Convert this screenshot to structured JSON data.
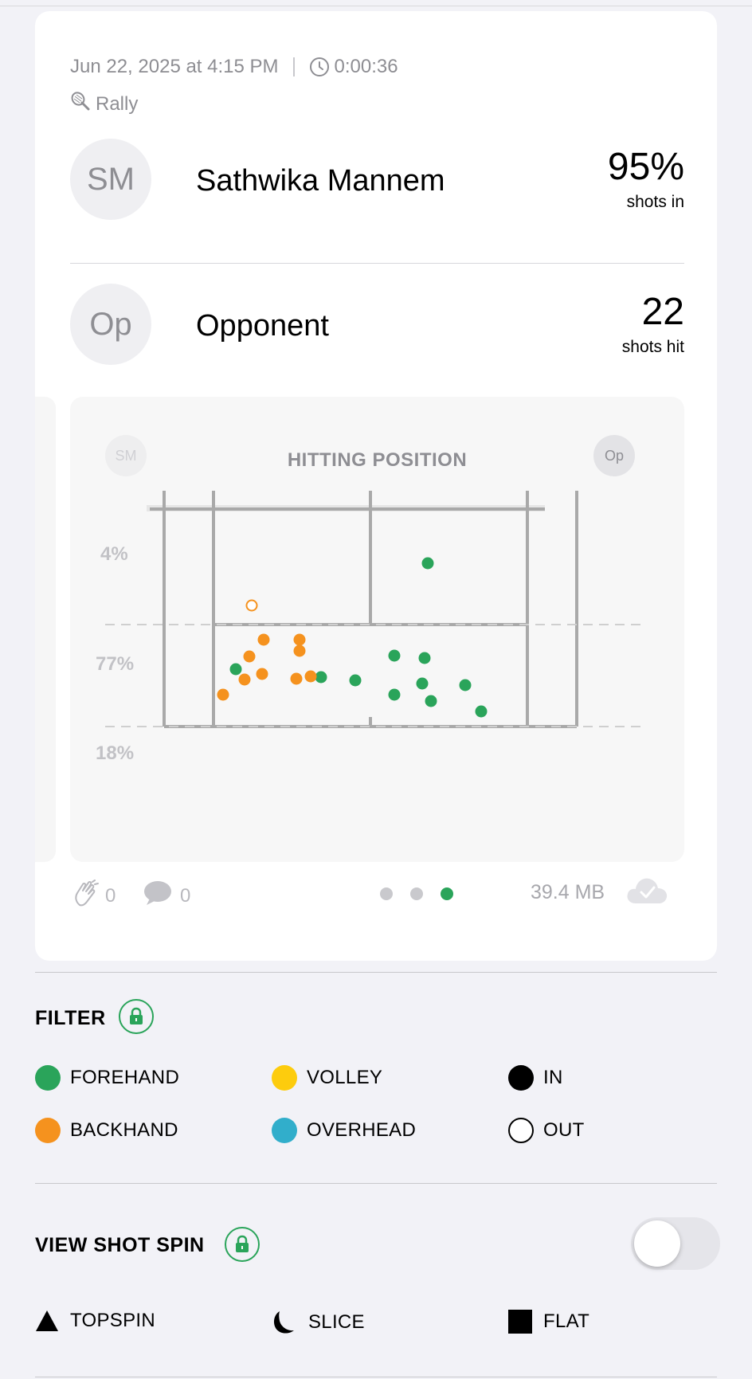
{
  "session": {
    "datetime": "Jun 22, 2025 at 4:15 PM",
    "duration": "0:00:36",
    "activity": "Rally"
  },
  "players": [
    {
      "initials": "SM",
      "name": "Sathwika Mannem",
      "stat_value": "95%",
      "stat_caption": "shots in"
    },
    {
      "initials": "Op",
      "name": "Opponent",
      "stat_value": "22",
      "stat_caption": "shots hit"
    }
  ],
  "court": {
    "title": "HITTING POSITION",
    "left_avatar": "SM",
    "right_avatar": "Op",
    "zone_percentages": [
      "4%",
      "77%",
      "18%"
    ]
  },
  "chart_data": {
    "type": "scatter",
    "title": "HITTING POSITION",
    "zones": [
      {
        "label": "4%",
        "value": 4
      },
      {
        "label": "77%",
        "value": 77
      },
      {
        "label": "18%",
        "value": 18
      }
    ],
    "series": [
      {
        "name": "FOREHAND",
        "color": "#2aa45a",
        "filled": true,
        "points": [
          [
            537,
            693
          ],
          [
            296,
            826
          ],
          [
            403,
            836
          ],
          [
            446,
            840
          ],
          [
            495,
            809
          ],
          [
            533,
            812
          ],
          [
            530,
            844
          ],
          [
            495,
            858
          ],
          [
            541,
            866
          ],
          [
            584,
            846
          ],
          [
            604,
            879
          ]
        ]
      },
      {
        "name": "BACKHAND",
        "color": "#f5921e",
        "filled": true,
        "points": [
          [
            331,
            789
          ],
          [
            376,
            789
          ],
          [
            376,
            803
          ],
          [
            313,
            810
          ],
          [
            307,
            839
          ],
          [
            329,
            832
          ],
          [
            372,
            838
          ],
          [
            390,
            835
          ],
          [
            280,
            858
          ]
        ]
      },
      {
        "name": "BACKHAND",
        "color": "#f5921e",
        "filled": false,
        "points": [
          [
            316,
            746
          ]
        ]
      }
    ]
  },
  "footer": {
    "claps": "0",
    "comments": "0",
    "pages": 3,
    "active_page": 3,
    "size": "39.4 MB"
  },
  "filter": {
    "title": "FILTER",
    "items": [
      {
        "label": "FOREHAND",
        "color": "#2aa45a"
      },
      {
        "label": "VOLLEY",
        "color": "#fdcc0d"
      },
      {
        "label": "IN",
        "color": "#000000"
      },
      {
        "label": "BACKHAND",
        "color": "#f5921e"
      },
      {
        "label": "OVERHEAD",
        "color": "#31aecb"
      },
      {
        "label": "OUT",
        "color": "#ffffff"
      }
    ]
  },
  "spin": {
    "title": "VIEW SHOT SPIN",
    "enabled": false,
    "items": [
      {
        "label": "TOPSPIN",
        "icon": "triangle-icon"
      },
      {
        "label": "SLICE",
        "icon": "crescent-icon"
      },
      {
        "label": "FLAT",
        "icon": "square-icon"
      }
    ]
  },
  "colors": {
    "accent": "#2aa45a",
    "backhand": "#f5921e"
  }
}
